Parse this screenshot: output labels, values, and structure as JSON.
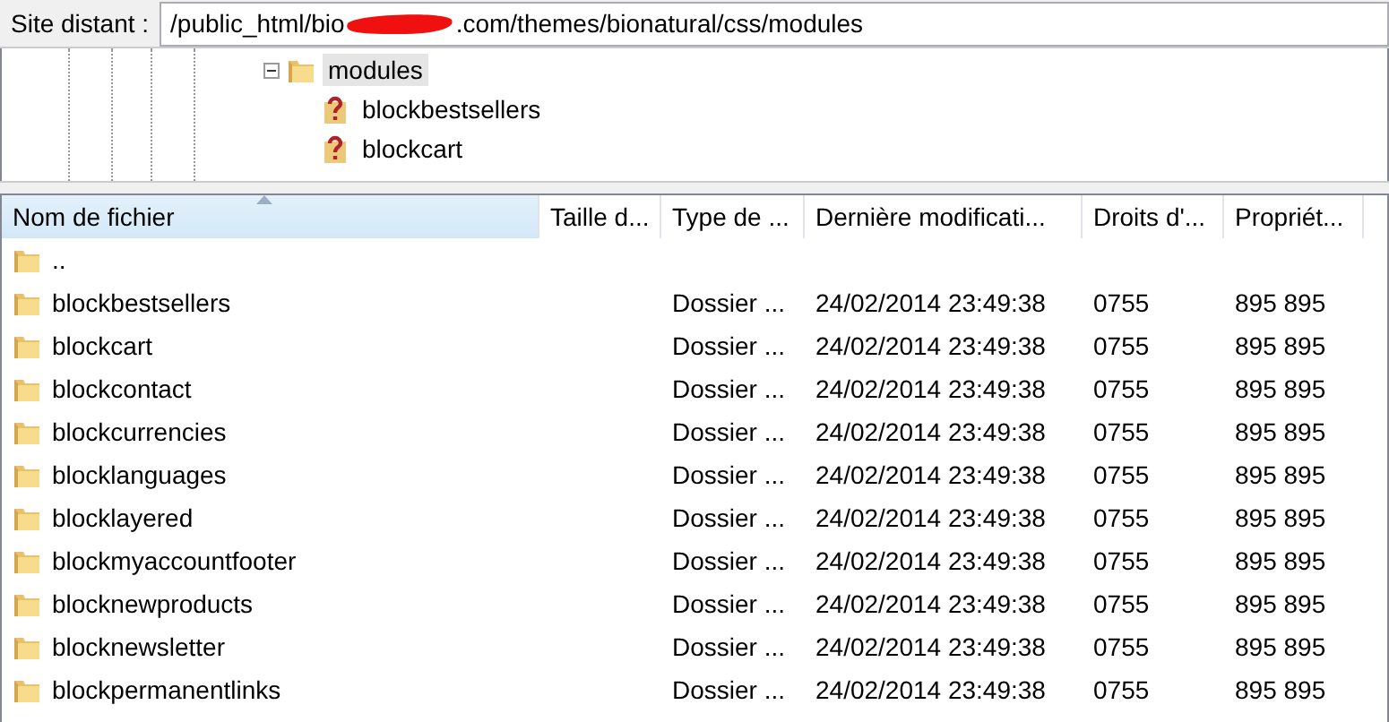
{
  "path_bar": {
    "label": "Site distant :",
    "path_before": "/public_html/bio",
    "redacted": true,
    "path_after": ".com/themes/bionatural/css/modules"
  },
  "tree": [
    {
      "name": "modules",
      "kind": "folder",
      "expanded": true,
      "selected": true,
      "children": [
        {
          "name": "blockbestsellers",
          "kind": "unknown",
          "selected": false
        },
        {
          "name": "blockcart",
          "kind": "unknown",
          "selected": false
        }
      ]
    }
  ],
  "table": {
    "columns": [
      {
        "label": "Nom de fichier",
        "sorted": true
      },
      {
        "label": "Taille d...",
        "sorted": false
      },
      {
        "label": "Type de ...",
        "sorted": false
      },
      {
        "label": "Dernière modificati...",
        "sorted": false
      },
      {
        "label": "Droits d'...",
        "sorted": false
      },
      {
        "label": "Propriét...",
        "sorted": false
      }
    ],
    "rows": [
      {
        "name": ".."
      },
      {
        "name": "blockbestsellers",
        "type": "Dossier ...",
        "modified": "24/02/2014 23:49:38",
        "rights": "0755",
        "owner": "895 895"
      },
      {
        "name": "blockcart",
        "type": "Dossier ...",
        "modified": "24/02/2014 23:49:38",
        "rights": "0755",
        "owner": "895 895"
      },
      {
        "name": "blockcontact",
        "type": "Dossier ...",
        "modified": "24/02/2014 23:49:38",
        "rights": "0755",
        "owner": "895 895"
      },
      {
        "name": "blockcurrencies",
        "type": "Dossier ...",
        "modified": "24/02/2014 23:49:38",
        "rights": "0755",
        "owner": "895 895"
      },
      {
        "name": "blocklanguages",
        "type": "Dossier ...",
        "modified": "24/02/2014 23:49:38",
        "rights": "0755",
        "owner": "895 895"
      },
      {
        "name": "blocklayered",
        "type": "Dossier ...",
        "modified": "24/02/2014 23:49:38",
        "rights": "0755",
        "owner": "895 895"
      },
      {
        "name": "blockmyaccountfooter",
        "type": "Dossier ...",
        "modified": "24/02/2014 23:49:38",
        "rights": "0755",
        "owner": "895 895"
      },
      {
        "name": "blocknewproducts",
        "type": "Dossier ...",
        "modified": "24/02/2014 23:49:38",
        "rights": "0755",
        "owner": "895 895"
      },
      {
        "name": "blocknewsletter",
        "type": "Dossier ...",
        "modified": "24/02/2014 23:49:38",
        "rights": "0755",
        "owner": "895 895"
      },
      {
        "name": "blockpermanentlinks",
        "type": "Dossier ...",
        "modified": "24/02/2014 23:49:38",
        "rights": "0755",
        "owner": "895 895"
      }
    ]
  }
}
